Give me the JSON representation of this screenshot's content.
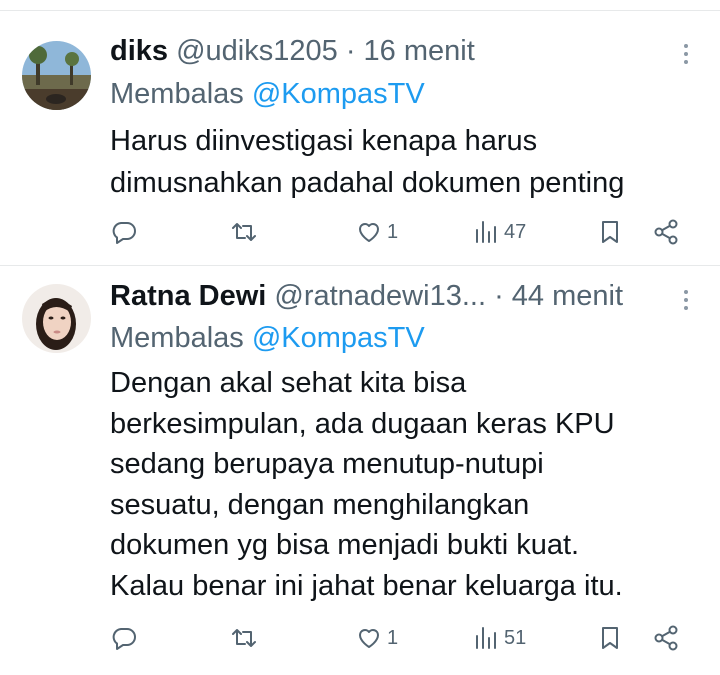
{
  "tweets": [
    {
      "name": "diks",
      "handle": "@udiks1205",
      "separator": "·",
      "time": "16 menit",
      "reply_prefix": "Membalas",
      "reply_mention": "@KompasTV",
      "text": "Harus diinvestigasi kenapa harus\ndimusnahkan padahal dokumen penting",
      "likes": "1",
      "views": "47"
    },
    {
      "name": "Ratna Dewi",
      "handle": "@ratnadewi13...",
      "separator": "·",
      "time": "44 menit",
      "reply_prefix": "Membalas",
      "reply_mention": "@KompasTV",
      "text": "Dengan akal sehat kita bisa\nberkesimpulan, ada dugaan keras KPU\nsedang berupaya menutup-nutupi\nsesuatu, dengan menghilangkan\ndokumen yg bisa menjadi bukti kuat.\nKalau benar ini jahat benar keluarga itu.",
      "likes": "1",
      "views": "51"
    }
  ],
  "colors": {
    "text": "#0f1419",
    "muted": "#536471",
    "link": "#1d9bf0",
    "divider": "#e7e9ea"
  },
  "icons": [
    "reply-icon",
    "retweet-icon",
    "heart-icon",
    "views-icon",
    "bookmark-icon",
    "share-icon",
    "more-icon"
  ]
}
